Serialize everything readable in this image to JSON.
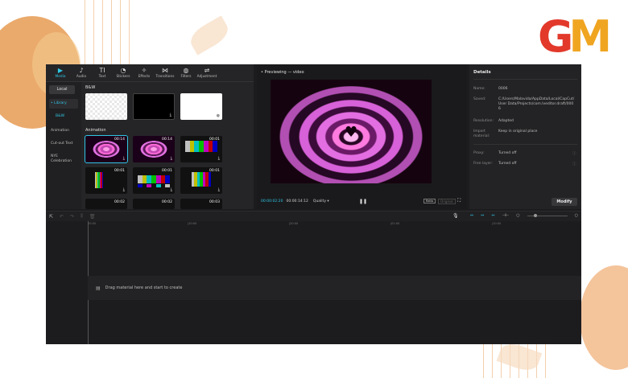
{
  "logo": {
    "text": "GM"
  },
  "toolbar": {
    "items": [
      {
        "label": "Media",
        "icon": "▶"
      },
      {
        "label": "Audio",
        "icon": "♪"
      },
      {
        "label": "Text",
        "icon": "TI"
      },
      {
        "label": "Stickers",
        "icon": "◔"
      },
      {
        "label": "Effects",
        "icon": "✧"
      },
      {
        "label": "Transitions",
        "icon": "⋈"
      },
      {
        "label": "Filters",
        "icon": "◍"
      },
      {
        "label": "Adjustment",
        "icon": "⇌"
      }
    ]
  },
  "sidebar": {
    "local": "Local",
    "library": "• Library",
    "bw": "B&W",
    "items": [
      "Animation",
      "Cut-out Text",
      "NYE Celebration"
    ]
  },
  "media": {
    "section1": "B&W",
    "section2": "Animation",
    "thumbs": [
      {
        "dur": "",
        "style": "checker"
      },
      {
        "dur": "",
        "style": "black"
      },
      {
        "dur": "",
        "style": "white"
      },
      {
        "dur": "00:14",
        "style": "heart"
      },
      {
        "dur": "00:14",
        "style": "heart"
      },
      {
        "dur": "00:01",
        "style": "bars"
      },
      {
        "dur": "00:01",
        "style": "bars"
      },
      {
        "dur": "00:01",
        "style": "bars"
      },
      {
        "dur": "00:01",
        "style": "bars"
      },
      {
        "dur": "00:02",
        "style": "bars"
      },
      {
        "dur": "00:02",
        "style": "bars"
      },
      {
        "dur": "00:03",
        "style": "bars"
      }
    ]
  },
  "preview": {
    "title": "• Previewing — video",
    "current_time": "00:00:02:20",
    "total_time": "00:00:14:12",
    "quality": "Quality ▾",
    "pause": "❚❚",
    "ratio": "Ratio",
    "original": "Original",
    "fullscreen": "⛶"
  },
  "details": {
    "title": "Details",
    "rows": [
      {
        "key": "Name:",
        "value": "0006"
      },
      {
        "key": "Saved:",
        "value": "C:/Users/Malavida/AppData/Local/CapCut/User Data/Projects/com.lveditor.draft/0006"
      },
      {
        "key": "Resolution:",
        "value": "Adapted"
      },
      {
        "key": "Import material:",
        "value": "Keep in original place"
      },
      {
        "key": "Proxy:",
        "value": "Turned off"
      },
      {
        "key": "Free layer:",
        "value": "Turned off"
      }
    ],
    "modify": "Modify"
  },
  "timeline": {
    "ruler": [
      "00:00",
      "|10:00",
      "|20:00",
      "|01:00",
      "|10:00",
      "|01:00"
    ],
    "drop_text": "Drag material here and start to create"
  },
  "colors": {
    "accent": "#2fc6e5",
    "panel": "#252527",
    "background": "#1c1c1e"
  }
}
